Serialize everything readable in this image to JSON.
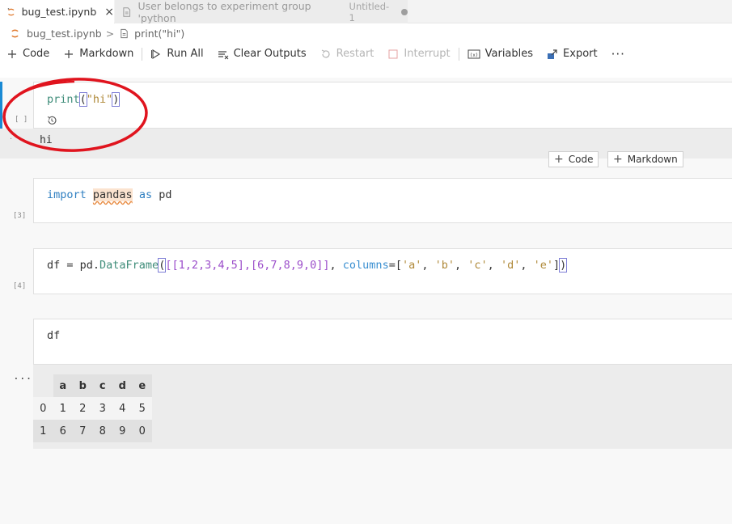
{
  "tabs": [
    {
      "label": "bug_test.ipynb",
      "close": "×"
    },
    {
      "label": "User belongs to experiment group 'python",
      "sublabel": "Untitled-1"
    }
  ],
  "breadcrumb": {
    "file": "bug_test.ipynb",
    "sep": ">",
    "cell": "print(\"hi\")"
  },
  "toolbar": {
    "code": "Code",
    "markdown": "Markdown",
    "run_all": "Run All",
    "clear_outputs": "Clear Outputs",
    "restart": "Restart",
    "interrupt": "Interrupt",
    "variables": "Variables",
    "export": "Export",
    "more": "···"
  },
  "cells": [
    {
      "exec": "[ ]",
      "output": "hi"
    },
    {
      "exec": "[3]"
    },
    {
      "exec": "[4]"
    },
    {
      "exec": "..."
    }
  ],
  "insert": {
    "code": "Code",
    "markdown": "Markdown"
  },
  "dataframe": {
    "columns": [
      "a",
      "b",
      "c",
      "d",
      "e"
    ],
    "rows": [
      {
        "index": "0",
        "values": [
          "1",
          "2",
          "3",
          "4",
          "5"
        ]
      },
      {
        "index": "1",
        "values": [
          "6",
          "7",
          "8",
          "9",
          "0"
        ]
      }
    ]
  },
  "colors": {
    "accent": "#1a8ad4",
    "annotation": "#e0141e"
  }
}
